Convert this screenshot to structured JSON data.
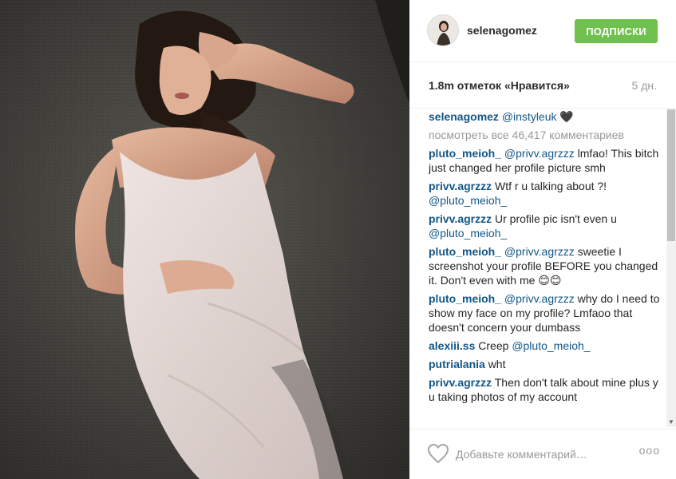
{
  "post": {
    "username": "selenagomez",
    "follow_label": "ПОДПИСКИ",
    "likes": "1.8m отметок «Нравится»",
    "age": "5 дн."
  },
  "comments": [
    {
      "user": "selenagomez",
      "mention": "@instyleuk",
      "text": "🖤"
    },
    {
      "view_all": "посмотреть все 46,417 комментариев"
    },
    {
      "user": "pluto_meioh_",
      "mention": "@privv.agrzzz",
      "text": "lmfao! This bitch just changed her profile picture smh"
    },
    {
      "user": "privv.agrzzz",
      "text": "Wtf r u talking about ?!",
      "mention_after": "@pluto_meioh_"
    },
    {
      "user": "privv.agrzzz",
      "text": "Ur profile pic isn't even u",
      "mention_after": "@pluto_meioh_"
    },
    {
      "user": "pluto_meioh_",
      "mention": "@privv.agrzzz",
      "text": "sweetie I screenshot your profile BEFORE you changed it. Don't even with me 😊😊"
    },
    {
      "user": "pluto_meioh_",
      "mention": "@privv.agrzzz",
      "text": "why do I need to show my face on my profile? Lmfaoo that doesn't concern your dumbass"
    },
    {
      "user": "alexiii.ss",
      "text": "Creep",
      "mention_after": "@pluto_meioh_"
    },
    {
      "user": "putrialania",
      "text": "wht"
    },
    {
      "user": "privv.agrzzz",
      "text": "Then don't talk about mine plus y u taking photos of my account"
    }
  ],
  "footer": {
    "placeholder": "Добавьте комментарий…",
    "more": "ooo",
    "heart_icon": "heart-outline-icon"
  },
  "colors": {
    "username_blue": "#125688",
    "follow_green": "#70c050",
    "muted_gray": "#999999"
  }
}
